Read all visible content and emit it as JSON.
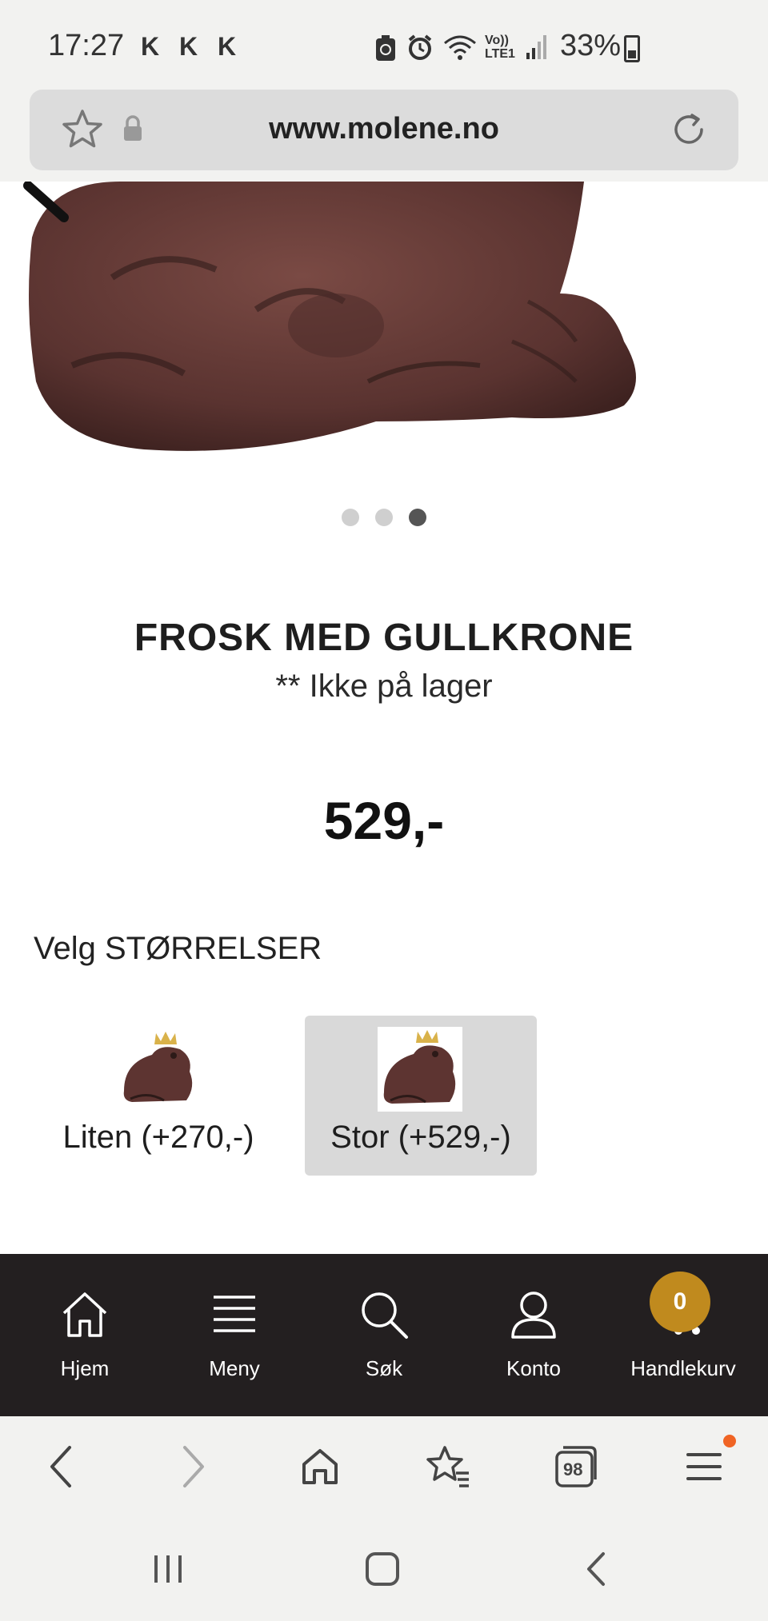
{
  "status_bar": {
    "time": "17:27",
    "notifications": [
      "K",
      "K",
      "K"
    ],
    "battery": "33%",
    "icons": [
      "recycle-icon",
      "alarm-icon",
      "wifi-icon",
      "volte-icon",
      "signal-icon",
      "battery-icon"
    ],
    "volte_label": "Vo)) LTE1"
  },
  "browser": {
    "url": "www.molene.no"
  },
  "product": {
    "title": "FROSK MED GULLKRONE",
    "stock_note": "** Ikke på lager",
    "price": "529,-",
    "carousel": {
      "total": 3,
      "active_index": 2
    }
  },
  "sizes": {
    "heading": "Velg STØRRELSER",
    "options": [
      {
        "label": "Liten (+270,-)",
        "selected": false
      },
      {
        "label": "Stor (+529,-)",
        "selected": true
      }
    ]
  },
  "site_nav": {
    "items": [
      {
        "label": "Hjem",
        "icon": "home-icon"
      },
      {
        "label": "Meny",
        "icon": "menu-icon"
      },
      {
        "label": "Søk",
        "icon": "search-icon"
      },
      {
        "label": "Konto",
        "icon": "user-icon"
      },
      {
        "label": "Handlekurv",
        "icon": "cart-icon"
      }
    ],
    "cart_count": "0"
  },
  "browser_toolbar": {
    "tab_count": "98",
    "icons": [
      "back-icon",
      "forward-icon",
      "home-icon",
      "bookmarks-icon",
      "tabs-icon",
      "menu-icon"
    ]
  },
  "colors": {
    "nav_bg": "#231f20",
    "cart_badge": "#c08a1e",
    "selected_option_bg": "#d9d9d9",
    "notification_dot": "#f06424"
  }
}
